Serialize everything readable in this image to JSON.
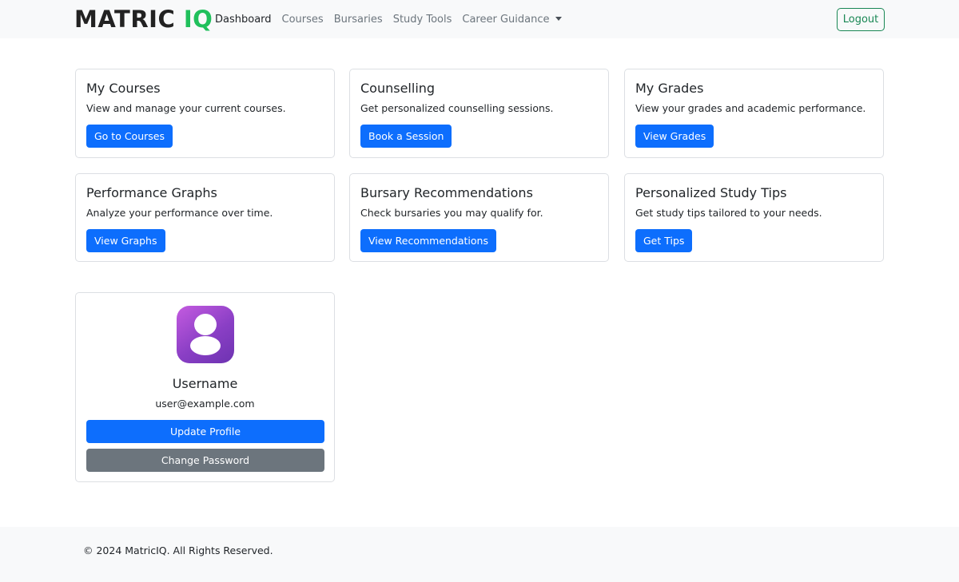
{
  "navbar": {
    "brand_part1": "MATRIC",
    "brand_part2": "IQ",
    "links": [
      {
        "label": "Dashboard"
      },
      {
        "label": "Courses"
      },
      {
        "label": "Bursaries"
      },
      {
        "label": "Study Tools"
      },
      {
        "label": "Career Guidance"
      }
    ],
    "logout_label": "Logout"
  },
  "cards": [
    {
      "title": "My Courses",
      "text": "View and manage your current courses.",
      "button": "Go to Courses"
    },
    {
      "title": "Counselling",
      "text": "Get personalized counselling sessions.",
      "button": "Book a Session"
    },
    {
      "title": "My Grades",
      "text": "View your grades and academic performance.",
      "button": "View Grades"
    },
    {
      "title": "Performance Graphs",
      "text": "Analyze your performance over time.",
      "button": "View Graphs"
    },
    {
      "title": "Bursary Recommendations",
      "text": "Check bursaries you may qualify for.",
      "button": "View Recommendations"
    },
    {
      "title": "Personalized Study Tips",
      "text": "Get study tips tailored to your needs.",
      "button": "Get Tips"
    }
  ],
  "profile": {
    "username": "Username",
    "email": "user@example.com",
    "update_label": "Update Profile",
    "change_password_label": "Change Password"
  },
  "footer": {
    "text": "© 2024 MatricIQ. All Rights Reserved."
  },
  "colors": {
    "primary": "#0d6efd",
    "secondary": "#6c757d",
    "success": "#198754",
    "brand_accent": "#20c05c",
    "avatar_gradient_start": "#c45be0",
    "avatar_gradient_end": "#6d33b1"
  }
}
